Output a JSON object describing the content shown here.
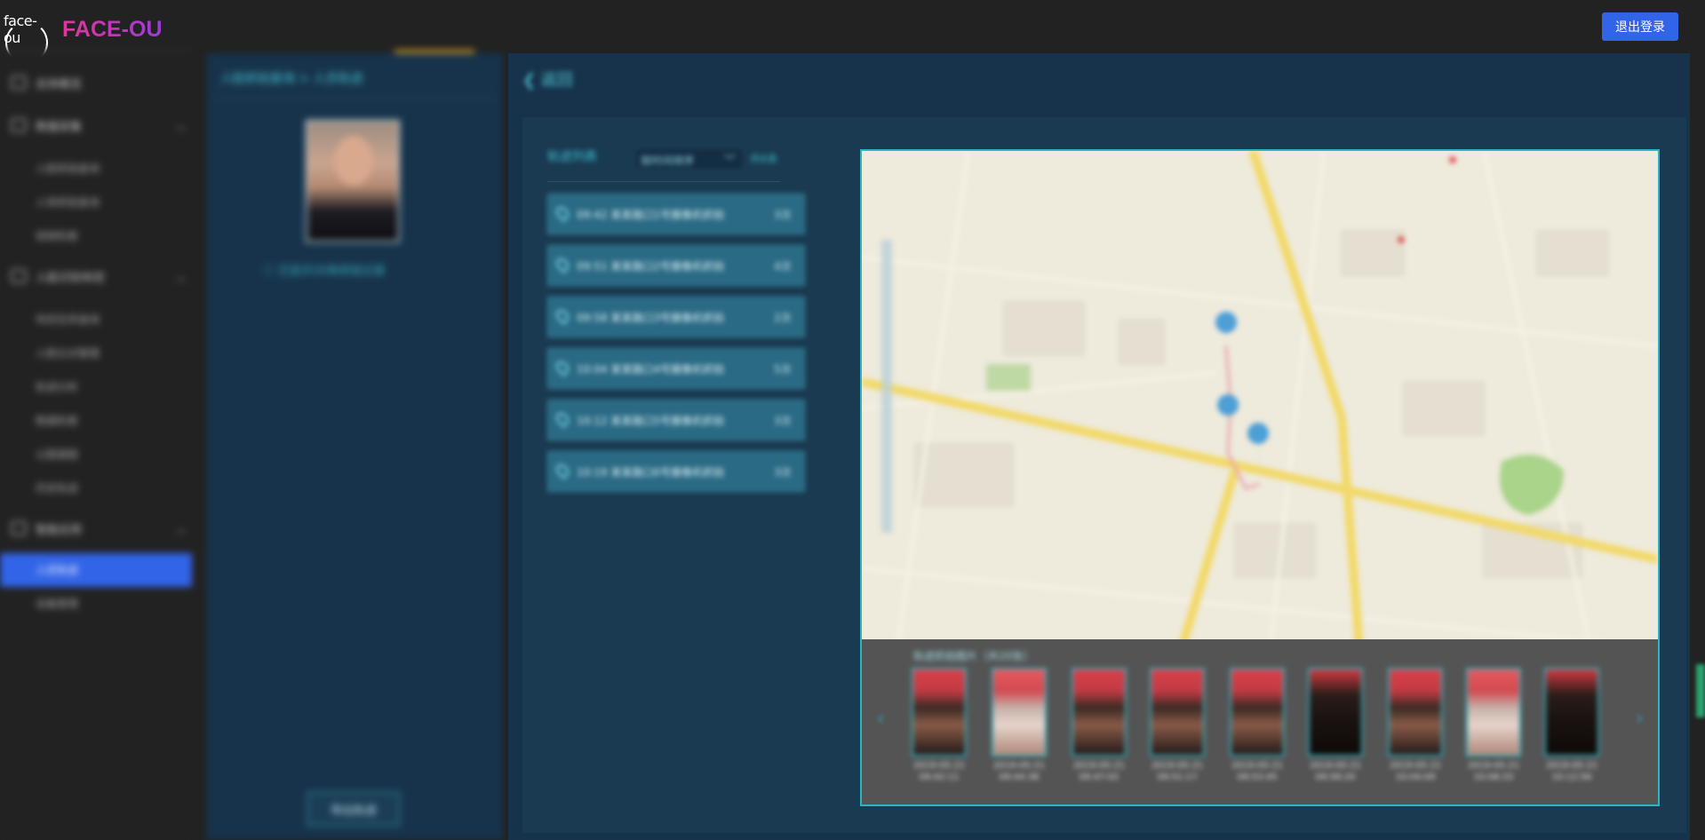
{
  "app": {
    "logo_text": "face-ou",
    "brand": "FACE-OU",
    "logout_label": "退出登录"
  },
  "sidebar": {
    "groups": [
      {
        "label": "总体概览",
        "icon": "dashboard-icon",
        "items": []
      },
      {
        "label": "数据采集",
        "icon": "database-icon",
        "items": [
          "人脸抓拍查询",
          "人体抓拍查询",
          "视频检索"
        ]
      },
      {
        "label": "人脸识别布控",
        "icon": "camera-icon",
        "items": [
          "布控任务查询",
          "人脸比对管理",
          "轨迹分析",
          "数据检索",
          "以图搜图",
          "历史轨迹"
        ]
      },
      {
        "label": "智能应用",
        "icon": "app-icon",
        "items": [
          "人员轨迹",
          "设备管理"
        ]
      }
    ],
    "active_item": "人员轨迹"
  },
  "detail": {
    "breadcrumb": "人脸抓拍查询 > 人员轨迹",
    "note": "ⓘ 已显示20条抓拍记录",
    "export_label": "导出轨迹"
  },
  "main": {
    "back_label": "返回",
    "list_title": "轨迹列表",
    "filter": {
      "value": "按时间排序"
    },
    "filter_tail": "共6条",
    "tracks": [
      {
        "text": "09:42 某某路口1号摄像机抓拍",
        "tail": "3次"
      },
      {
        "text": "09:51 某某路口2号摄像机抓拍",
        "tail": "4次"
      },
      {
        "text": "09:58 某某路口3号摄像机抓拍",
        "tail": "2次"
      },
      {
        "text": "10:04 某某路口4号摄像机抓拍",
        "tail": "5次"
      },
      {
        "text": "10:12 某某路口5号摄像机抓拍",
        "tail": "3次"
      },
      {
        "text": "10:19 某某路口6号摄像机抓拍",
        "tail": "3次"
      }
    ]
  },
  "strip": {
    "title": "轨迹抓拍图片（共20张）",
    "thumbs": [
      {
        "time": "2019-05-21 09:42:11"
      },
      {
        "time": "2019-05-21 09:44:38"
      },
      {
        "time": "2019-05-21 09:47:02"
      },
      {
        "time": "2019-05-21 09:51:17"
      },
      {
        "time": "2019-05-21 09:53:45"
      },
      {
        "time": "2019-05-21 09:58:20"
      },
      {
        "time": "2019-05-21 10:04:09"
      },
      {
        "time": "2019-05-21 10:08:33"
      },
      {
        "time": "2019-05-21 10:12:56"
      }
    ]
  },
  "colors": {
    "accent": "#3264e8",
    "panel": "#17334b",
    "cyan": "#2bb3c6",
    "orange_accent": "#d49a1f"
  }
}
